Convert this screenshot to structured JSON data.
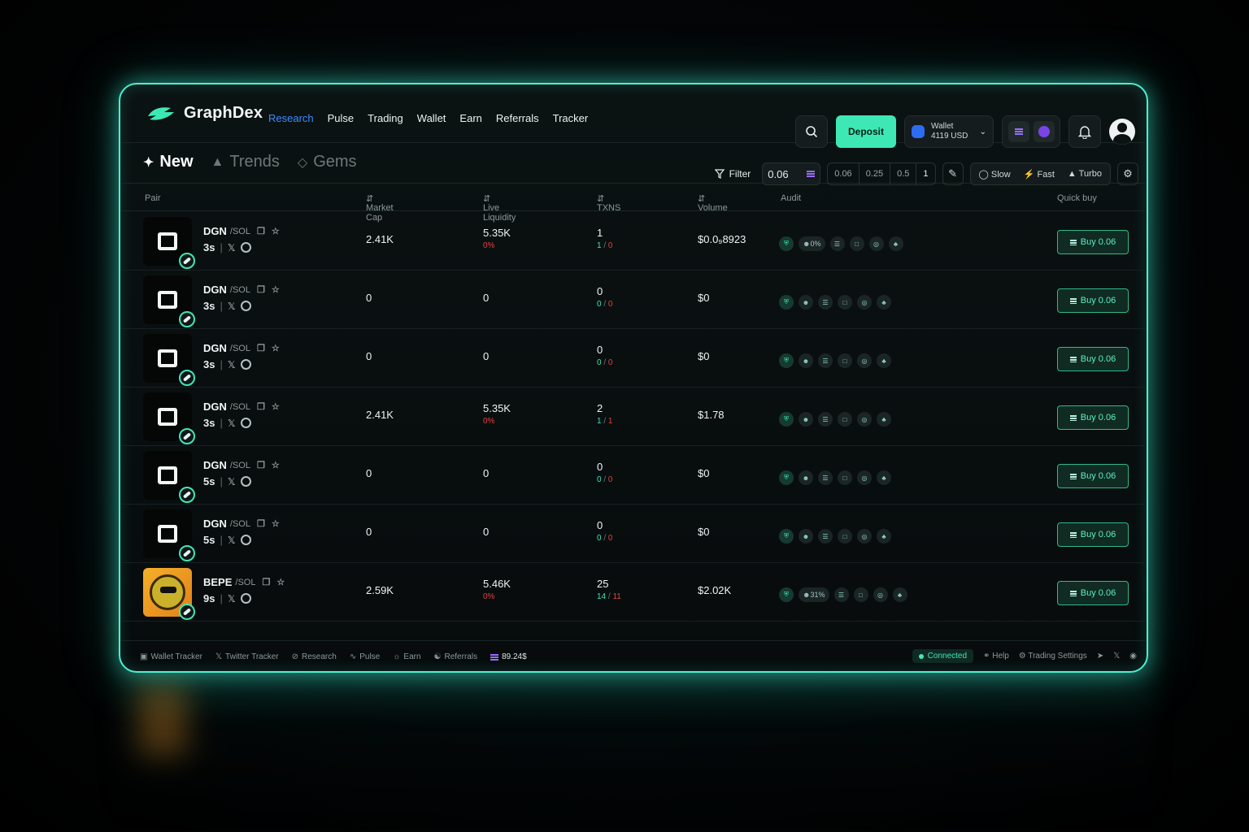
{
  "brand": {
    "name": "GraphDex"
  },
  "nav": [
    "Research",
    "Pulse",
    "Trading",
    "Wallet",
    "Earn",
    "Referrals",
    "Tracker"
  ],
  "nav_active": "Research",
  "header": {
    "deposit_label": "Deposit",
    "wallet_label": "Wallet",
    "wallet_balance": "4119 USD"
  },
  "tabs": [
    "New",
    "Trends",
    "Gems"
  ],
  "filters": {
    "filter_label": "Filter",
    "amount": "0.06",
    "presets": [
      "0.06",
      "0.25",
      "0.5",
      "1"
    ],
    "speeds": [
      "Slow",
      "Fast",
      "Turbo"
    ]
  },
  "columns": {
    "pair": "Pair",
    "market_cap": "Market Cap",
    "liquidity": "Live Liquidity",
    "txns": "TXNS",
    "volume": "Volume",
    "audit": "Audit",
    "quick_buy": "Quick buy"
  },
  "rows": [
    {
      "ticker": "DGN",
      "pair": "/SOL",
      "age": "3s",
      "mcap": "2.41K",
      "liq": "5.35K",
      "liq_change": "0%",
      "txns": "1",
      "buys": "1",
      "sells": "0",
      "volume": "$0.0₉8923",
      "holders": "0%",
      "buy": "Buy 0.06"
    },
    {
      "ticker": "DGN",
      "pair": "/SOL",
      "age": "3s",
      "mcap": "0",
      "liq": "0",
      "liq_change": "",
      "txns": "0",
      "buys": "0",
      "sells": "0",
      "volume": "$0",
      "holders": "",
      "buy": "Buy 0.06"
    },
    {
      "ticker": "DGN",
      "pair": "/SOL",
      "age": "3s",
      "mcap": "0",
      "liq": "0",
      "liq_change": "",
      "txns": "0",
      "buys": "0",
      "sells": "0",
      "volume": "$0",
      "holders": "",
      "buy": "Buy 0.06"
    },
    {
      "ticker": "DGN",
      "pair": "/SOL",
      "age": "3s",
      "mcap": "2.41K",
      "liq": "5.35K",
      "liq_change": "0%",
      "txns": "2",
      "buys": "1",
      "sells": "1",
      "volume": "$1.78",
      "holders": "",
      "buy": "Buy 0.06"
    },
    {
      "ticker": "DGN",
      "pair": "/SOL",
      "age": "5s",
      "mcap": "0",
      "liq": "0",
      "liq_change": "",
      "txns": "0",
      "buys": "0",
      "sells": "0",
      "volume": "$0",
      "holders": "",
      "buy": "Buy 0.06"
    },
    {
      "ticker": "DGN",
      "pair": "/SOL",
      "age": "5s",
      "mcap": "0",
      "liq": "0",
      "liq_change": "",
      "txns": "0",
      "buys": "0",
      "sells": "0",
      "volume": "$0",
      "holders": "",
      "buy": "Buy 0.06"
    },
    {
      "ticker": "BEPE",
      "pair": "/SOL",
      "age": "9s",
      "mcap": "2.59K",
      "liq": "5.46K",
      "liq_change": "0%",
      "txns": "25",
      "buys": "14",
      "sells": "11",
      "volume": "$2.02K",
      "holders": "31%",
      "buy": "Buy 0.06"
    }
  ],
  "footer": {
    "links": [
      "Wallet Tracker",
      "Twitter Tracker",
      "Research",
      "Pulse",
      "Earn",
      "Referrals"
    ],
    "balance": "89.24$",
    "status": "Connected",
    "help": "Help",
    "trading_settings": "Trading Settings"
  },
  "colors": {
    "accent": "#3ee8b5",
    "glow": "#4ff0d0",
    "nav_active": "#3f8cff",
    "sell": "#e0423f"
  }
}
